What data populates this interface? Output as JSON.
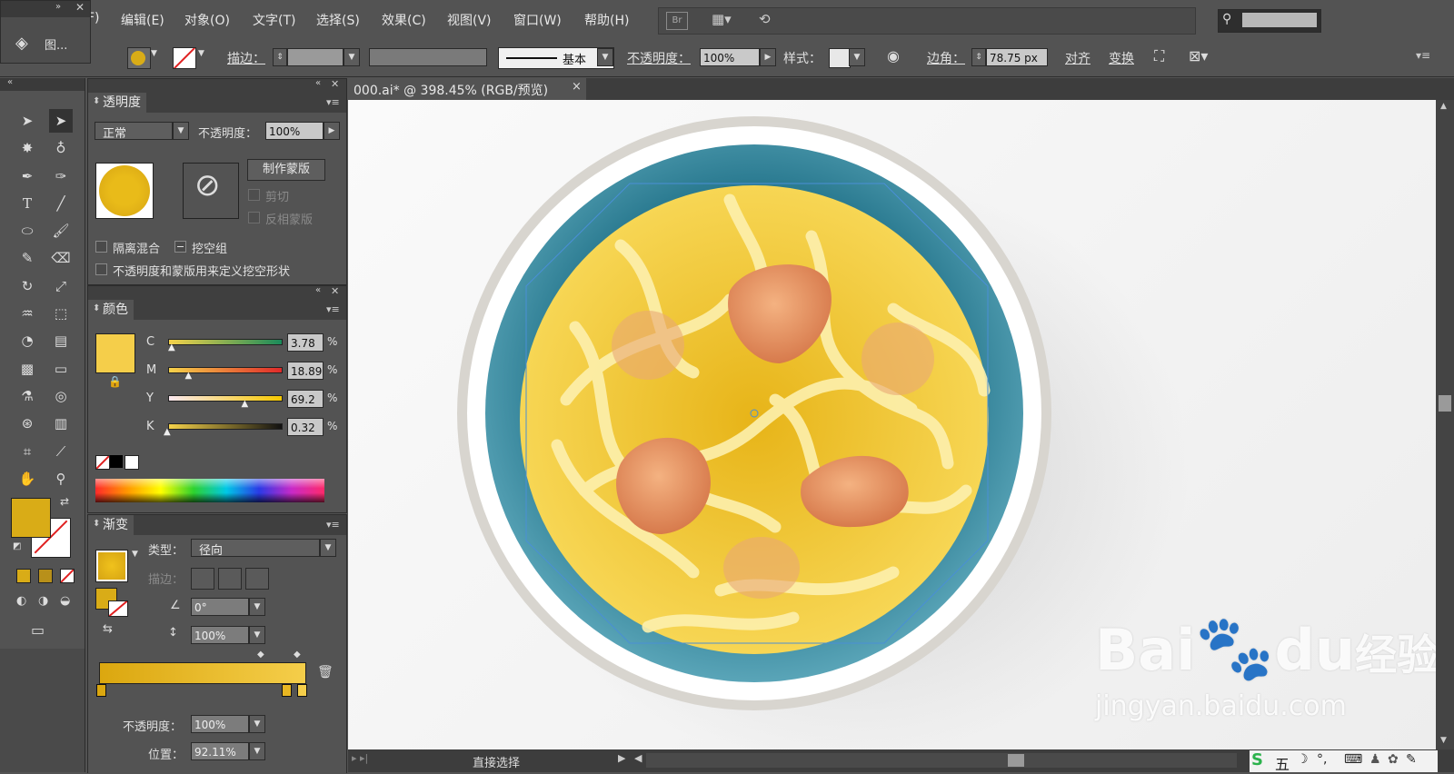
{
  "menu": {
    "file_partial": "F)",
    "edit": "编辑(E)",
    "object": "对象(O)",
    "type": "文字(T)",
    "select": "选择(S)",
    "effect": "效果(C)",
    "view": "视图(V)",
    "window": "窗口(W)",
    "help": "帮助(H)",
    "br": "Br"
  },
  "mini_panel": {
    "label": "图..."
  },
  "control": {
    "stroke_label": "描边：",
    "stroke_style": "基本",
    "opacity_label": "不透明度：",
    "opacity_value": "100%",
    "style_label": "样式：",
    "corner_label": "边角：",
    "corner_value": "78.75 px",
    "align": "对齐",
    "transform": "变换"
  },
  "document_tab": {
    "title": "000.ai* @ 398.45% (RGB/预览)",
    "close": "×"
  },
  "transparency": {
    "title": "透明度",
    "blend_mode": "正常",
    "opacity_label": "不透明度：",
    "opacity_value": "100%",
    "make_mask": "制作蒙版",
    "clip": "剪切",
    "invert_mask": "反相蒙版",
    "isolate_blend": "隔离混合",
    "knockout_group": "挖空组",
    "opacity_mask_knockout": "不透明度和蒙版用来定义挖空形状"
  },
  "color": {
    "title": "颜色",
    "channels": [
      {
        "name": "C",
        "value": "3.78",
        "unit": "%",
        "fraction": 0.04
      },
      {
        "name": "M",
        "value": "18.89",
        "unit": "%",
        "fraction": 0.19
      },
      {
        "name": "Y",
        "value": "69.2",
        "unit": "%",
        "fraction": 0.69
      },
      {
        "name": "K",
        "value": "0.32",
        "unit": "%",
        "fraction": 0.0
      }
    ],
    "fill_color": "#f5ce4a"
  },
  "gradient": {
    "title": "渐变",
    "type_label": "类型：",
    "type_value": "径向",
    "stroke_label": "描边：",
    "angle_value": "0°",
    "aspect_value": "100%",
    "opacity_label": "不透明度：",
    "opacity_value": "100%",
    "position_label": "位置：",
    "position_value": "92.11%"
  },
  "status": {
    "tool": "直接选择"
  },
  "ime": {
    "label": "五"
  },
  "watermark": {
    "text1": "Bai",
    "text2": "du",
    "text3": "经验",
    "url": "jingyan.baidu.com"
  },
  "colors": {
    "accent_orange": "#f39a2e",
    "bowl_teal": "#2f7f95",
    "noodle_yellow": "#f5ce4a",
    "meat": "#e0895a"
  }
}
